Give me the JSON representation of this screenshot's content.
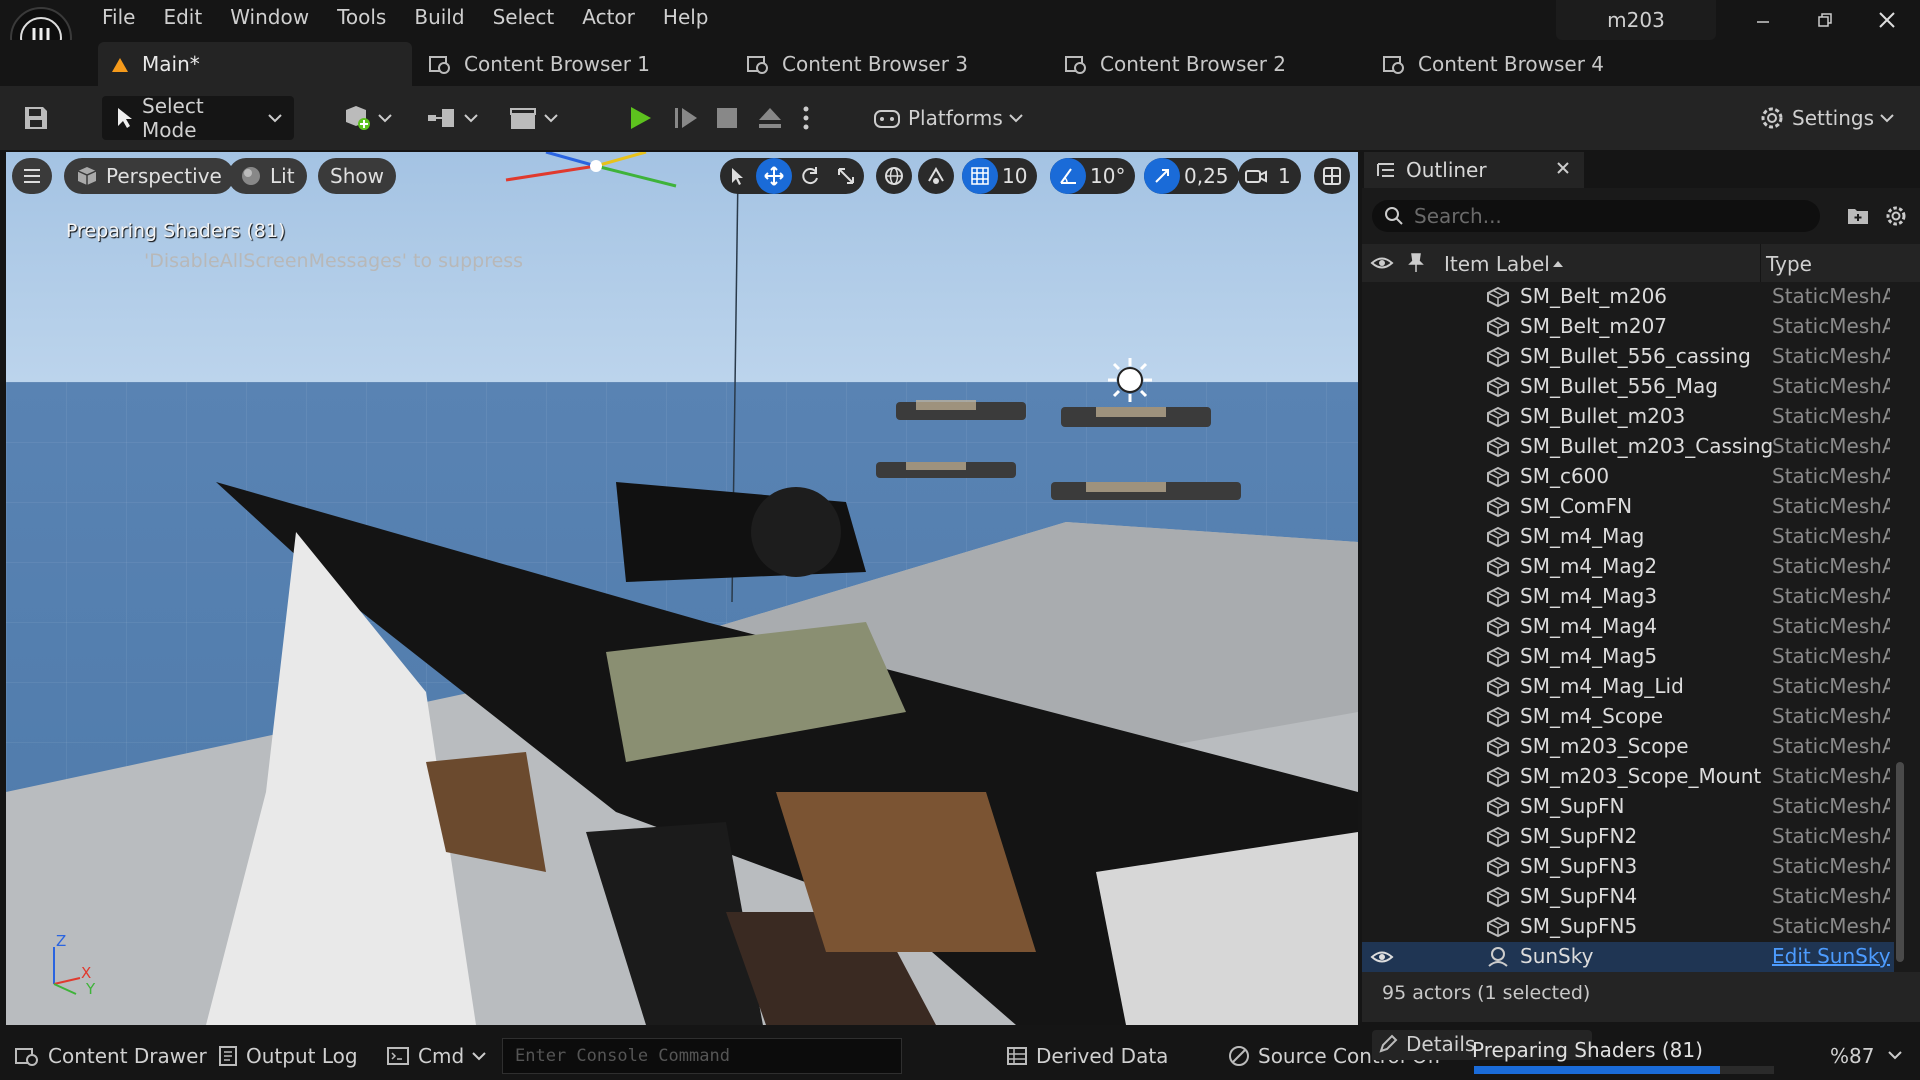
{
  "app": {
    "project_name": "m203"
  },
  "menu": [
    "File",
    "Edit",
    "Window",
    "Tools",
    "Build",
    "Select",
    "Actor",
    "Help"
  ],
  "tabs": [
    {
      "label": "Main*",
      "active": true
    },
    {
      "label": "Content Browser 1"
    },
    {
      "label": "Content Browser 3"
    },
    {
      "label": "Content Browser 2"
    },
    {
      "label": "Content Browser 4"
    }
  ],
  "toolbar": {
    "select_mode": "Select Mode",
    "platforms": "Platforms",
    "settings": "Settings"
  },
  "viewport": {
    "perspective": "Perspective",
    "lit": "Lit",
    "show": "Show",
    "grid_snap": "10",
    "rot_snap": "10°",
    "scale_snap": "0,25",
    "cam_speed": "1",
    "message": "Preparing Shaders (81)",
    "message_hint": "'DisableAllScreenMessages' to suppress",
    "axis_z": "Z",
    "axis_x": "X",
    "axis_y": "Y"
  },
  "outliner": {
    "title": "Outliner",
    "search_placeholder": "Search...",
    "col_label": "Item Label",
    "col_type": "Type",
    "rows": [
      {
        "name": "SM_Belt_m206",
        "type": "StaticMeshAc"
      },
      {
        "name": "SM_Belt_m207",
        "type": "StaticMeshAc"
      },
      {
        "name": "SM_Bullet_556_cassing",
        "type": "StaticMeshAc"
      },
      {
        "name": "SM_Bullet_556_Mag",
        "type": "StaticMeshAc"
      },
      {
        "name": "SM_Bullet_m203",
        "type": "StaticMeshAc"
      },
      {
        "name": "SM_Bullet_m203_Cassing",
        "type": "StaticMeshAc"
      },
      {
        "name": "SM_c600",
        "type": "StaticMeshAc"
      },
      {
        "name": "SM_ComFN",
        "type": "StaticMeshAc"
      },
      {
        "name": "SM_m4_Mag",
        "type": "StaticMeshAc"
      },
      {
        "name": "SM_m4_Mag2",
        "type": "StaticMeshAc"
      },
      {
        "name": "SM_m4_Mag3",
        "type": "StaticMeshAc"
      },
      {
        "name": "SM_m4_Mag4",
        "type": "StaticMeshAc"
      },
      {
        "name": "SM_m4_Mag5",
        "type": "StaticMeshAc"
      },
      {
        "name": "SM_m4_Mag_Lid",
        "type": "StaticMeshAc"
      },
      {
        "name": "SM_m4_Scope",
        "type": "StaticMeshAc"
      },
      {
        "name": "SM_m203_Scope",
        "type": "StaticMeshAc"
      },
      {
        "name": "SM_m203_Scope_Mount",
        "type": "StaticMeshAc"
      },
      {
        "name": "SM_SupFN",
        "type": "StaticMeshAc"
      },
      {
        "name": "SM_SupFN2",
        "type": "StaticMeshAc"
      },
      {
        "name": "SM_SupFN3",
        "type": "StaticMeshAc"
      },
      {
        "name": "SM_SupFN4",
        "type": "StaticMeshAc"
      },
      {
        "name": "SM_SupFN5",
        "type": "StaticMeshAc"
      },
      {
        "name": "SunSky",
        "type": "Edit SunSky",
        "selected": true
      }
    ],
    "footer": "95 actors (1 selected)"
  },
  "status": {
    "content_drawer": "Content Drawer",
    "output_log": "Output Log",
    "cmd": "Cmd",
    "console_placeholder": "Enter Console Command",
    "derived_data": "Derived Data",
    "source_control": "Source Control Off",
    "details": "Details",
    "preparing": "Preparing Shaders (81)",
    "percent": "%87",
    "progress": 0.82
  },
  "colors": {
    "accent": "#1a6bd8",
    "play": "#5dc21e",
    "link": "#4d9cff"
  }
}
